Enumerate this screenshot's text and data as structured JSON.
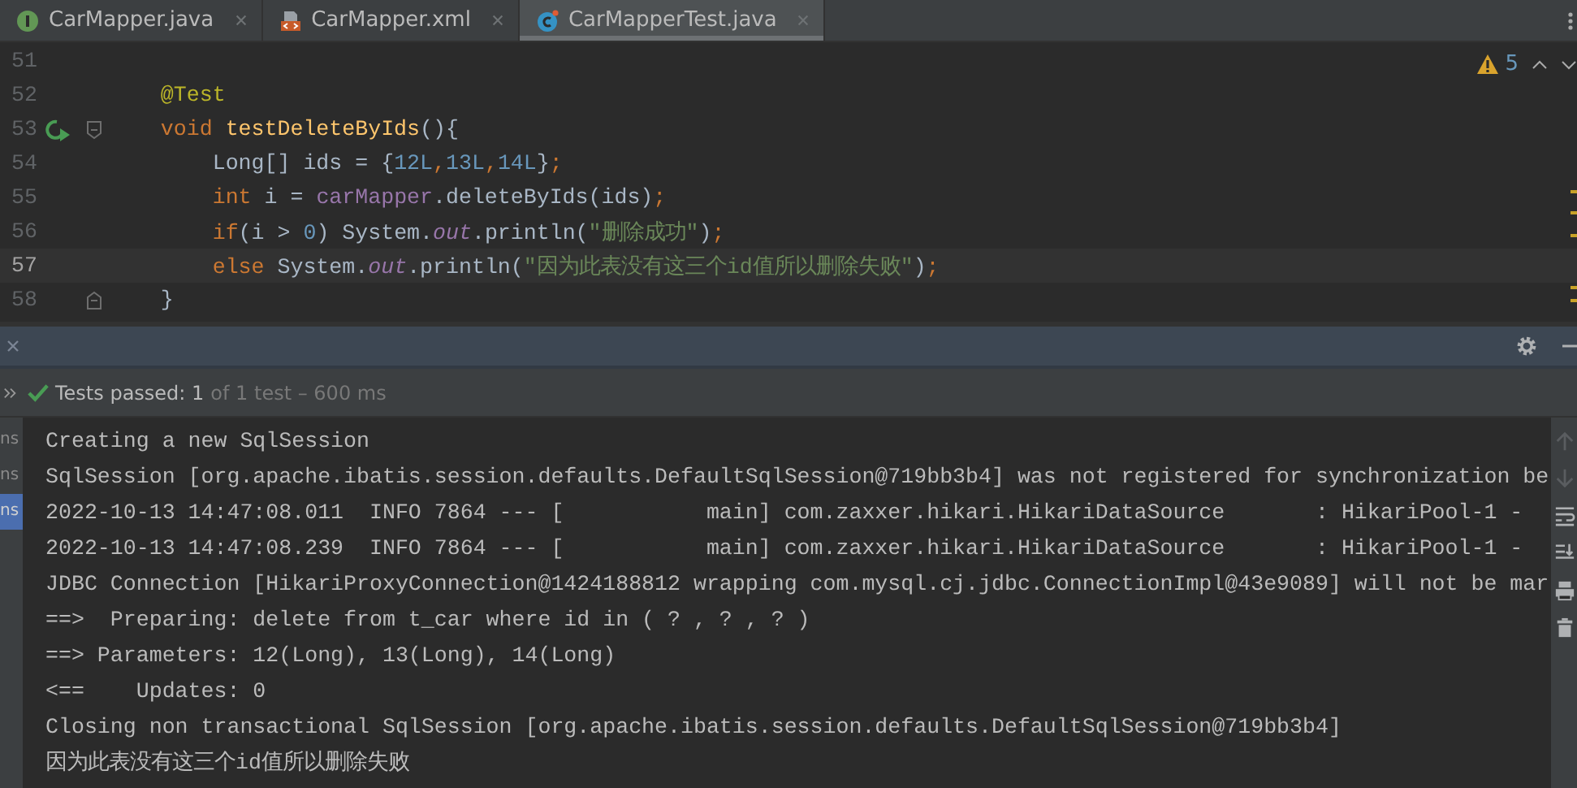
{
  "tabs": [
    {
      "label": "CarMapper.java",
      "selected": false
    },
    {
      "label": "CarMapper.xml",
      "selected": false
    },
    {
      "label": "CarMapperTest.java",
      "selected": true
    }
  ],
  "editor": {
    "warning_count": "5",
    "lines": [
      {
        "number": "51",
        "current": false,
        "kind": "plain"
      },
      {
        "number": "52",
        "current": false,
        "kind": "plain",
        "tokens": [
          {
            "kind": "annotation",
            "text": "    @Test"
          }
        ]
      },
      {
        "number": "53",
        "current": false,
        "kind": "run",
        "tokens": [
          {
            "kind": "keyword",
            "text": "    void "
          },
          {
            "kind": "method",
            "text": "testDeleteByIds"
          },
          {
            "kind": "plain",
            "text": "(){"
          }
        ]
      },
      {
        "number": "54",
        "current": false,
        "kind": "plain",
        "tokens": [
          {
            "kind": "plain",
            "text": "        Long[] ids = {"
          },
          {
            "kind": "number",
            "text": "12L"
          },
          {
            "kind": "keyword",
            "text": ","
          },
          {
            "kind": "number",
            "text": "13L"
          },
          {
            "kind": "keyword",
            "text": ","
          },
          {
            "kind": "number",
            "text": "14L"
          },
          {
            "kind": "plain",
            "text": "}"
          },
          {
            "kind": "keyword",
            "text": ";"
          }
        ]
      },
      {
        "number": "55",
        "current": false,
        "kind": "plain",
        "tokens": [
          {
            "kind": "keyword",
            "text": "        int"
          },
          {
            "kind": "plain",
            "text": " i = "
          },
          {
            "kind": "field",
            "text": "carMapper"
          },
          {
            "kind": "plain",
            "text": ".deleteByIds(ids)"
          },
          {
            "kind": "keyword",
            "text": ";"
          }
        ]
      },
      {
        "number": "56",
        "current": false,
        "kind": "plain",
        "tokens": [
          {
            "kind": "keyword",
            "text": "        if"
          },
          {
            "kind": "plain",
            "text": "(i > "
          },
          {
            "kind": "number",
            "text": "0"
          },
          {
            "kind": "plain",
            "text": ") System."
          },
          {
            "kind": "static",
            "text": "out"
          },
          {
            "kind": "plain",
            "text": ".println("
          },
          {
            "kind": "string",
            "text": "\"删除成功\""
          },
          {
            "kind": "plain",
            "text": ")"
          },
          {
            "kind": "keyword",
            "text": ";"
          }
        ]
      },
      {
        "number": "57",
        "current": true,
        "kind": "plain",
        "tokens": [
          {
            "kind": "keyword",
            "text": "        else"
          },
          {
            "kind": "plain",
            "text": " System."
          },
          {
            "kind": "static",
            "text": "out"
          },
          {
            "kind": "plain",
            "text": ".println("
          },
          {
            "kind": "string",
            "text": "\"因为此表没有这三个id值所以删除失败\""
          },
          {
            "kind": "plain",
            "text": ")"
          },
          {
            "kind": "keyword",
            "text": ";"
          }
        ]
      },
      {
        "number": "58",
        "current": false,
        "kind": "fold",
        "tokens": [
          {
            "kind": "plain",
            "text": "    }"
          }
        ]
      }
    ]
  },
  "run_panel": {
    "status_label": "Tests passed: 1",
    "status_detail": "of 1 test – 600 ms",
    "side_items": [
      {
        "label": "ns",
        "selected": false
      },
      {
        "label": "ns",
        "selected": false
      },
      {
        "label": "ns",
        "selected": true
      }
    ],
    "console": [
      "Creating a new SqlSession",
      "SqlSession [org.apache.ibatis.session.defaults.DefaultSqlSession@719bb3b4] was not registered for synchronization be",
      "2022-10-13 14:47:08.011  INFO 7864 --- [           main] com.zaxxer.hikari.HikariDataSource       : HikariPool-1 -",
      "2022-10-13 14:47:08.239  INFO 7864 --- [           main] com.zaxxer.hikari.HikariDataSource       : HikariPool-1 -",
      "JDBC Connection [HikariProxyConnection@1424188812 wrapping com.mysql.cj.jdbc.ConnectionImpl@43e9089] will not be mar",
      "==>  Preparing: delete from t_car where id in ( ? , ? , ? )",
      "==> Parameters: 12(Long), 13(Long), 14(Long)",
      "<==    Updates: 0",
      "Closing non transactional SqlSession [org.apache.ibatis.session.defaults.DefaultSqlSession@719bb3b4]",
      "因为此表没有这三个id值所以删除失败"
    ]
  }
}
